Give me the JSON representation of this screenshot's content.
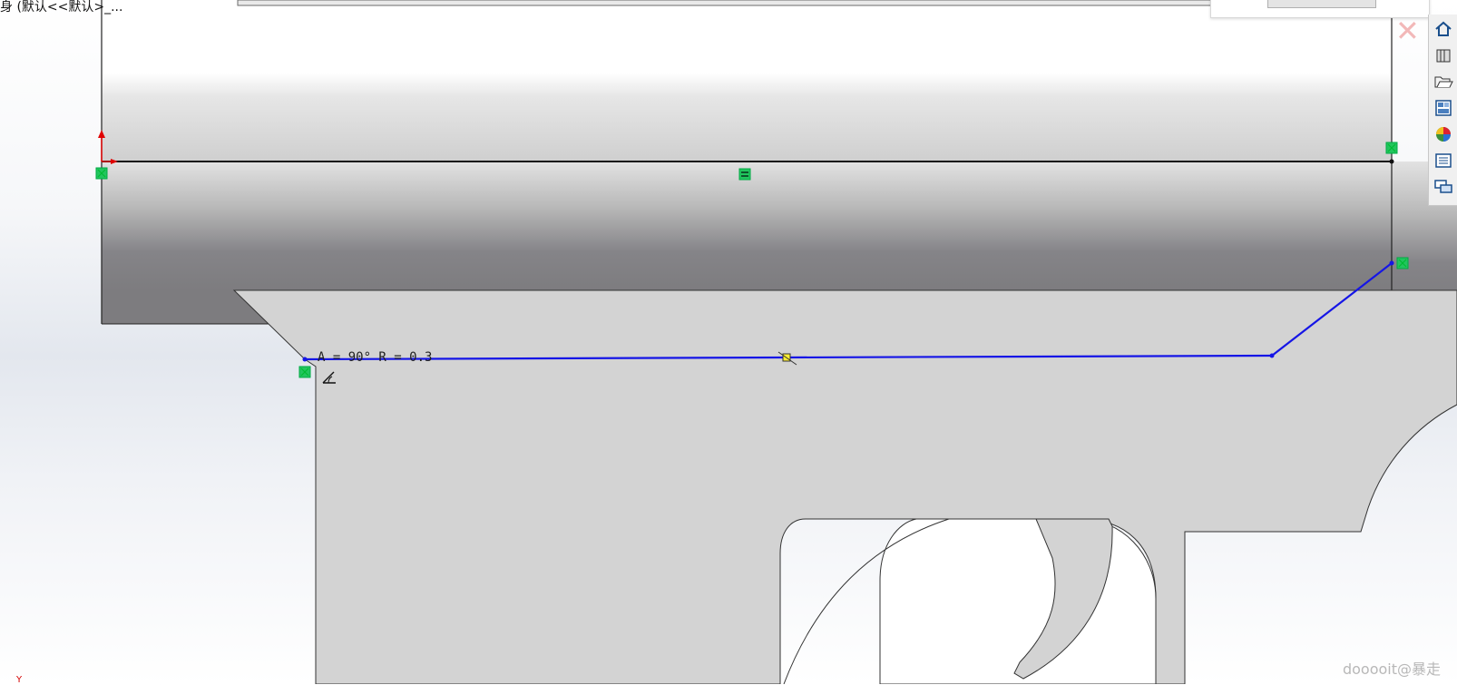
{
  "document": {
    "title_fragment": "身 (默认<<默认>_..."
  },
  "sketch": {
    "dimension_text": "A = 90°  R = 0.3",
    "colors": {
      "active_sketch": "#1515e6",
      "relation_marker": "#22c55e",
      "origin_red": "#e00000",
      "body_dark": "#7d7c7f",
      "body_light": "#d3d3d3"
    }
  },
  "close_icon": "✕",
  "task_pane": {
    "items": [
      {
        "name": "home",
        "icon": "home-icon"
      },
      {
        "name": "design-library",
        "icon": "design-library-icon"
      },
      {
        "name": "file-explorer",
        "icon": "folder-open-icon"
      },
      {
        "name": "view-palette",
        "icon": "view-palette-icon"
      },
      {
        "name": "appearances",
        "icon": "appearances-icon"
      },
      {
        "name": "custom-properties",
        "icon": "properties-list-icon"
      },
      {
        "name": "forum",
        "icon": "chat-icon"
      }
    ]
  },
  "axis_label": "Y",
  "watermark": "dooooit@暴走"
}
